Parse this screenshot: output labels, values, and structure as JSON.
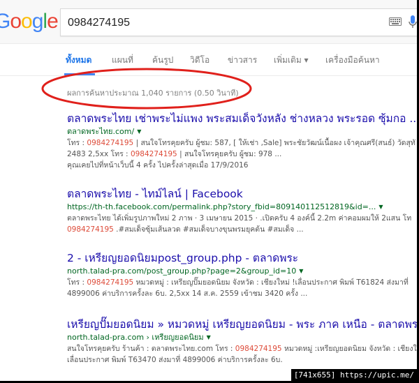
{
  "search": {
    "logo_letters": [
      {
        "ch": "G",
        "color": "#4285f4"
      },
      {
        "ch": "o",
        "color": "#ea4335"
      },
      {
        "ch": "o",
        "color": "#fbbc05"
      },
      {
        "ch": "g",
        "color": "#4285f4"
      },
      {
        "ch": "l",
        "color": "#34a853"
      },
      {
        "ch": "e",
        "color": "#ea4335"
      }
    ],
    "query": "0984274195"
  },
  "tabs": [
    "ทั้งหมด",
    "แผนที่",
    "ค้นรูป",
    "วิดีโอ",
    "ข่าวสาร",
    "เพิ่มเติม ▾",
    "เครื่องมือค้นหา"
  ],
  "stats": "ผลการค้นหาประมาณ 1,040 รายการ (0.50 วินาที)",
  "results": [
    {
      "title": "ตลาดพระไทย เช่าพระไม่แพง พระสมเด็จวังหลัง ช่างหลวง พระรอด ซุ้มกอ ...",
      "url": "ตลาดพระไทย.com/",
      "snippet_lines": [
        [
          {
            "t": "โทร : "
          },
          {
            "t": "0984274195",
            "hl": true
          },
          {
            "t": " | สนใจโทรคุยครับ ผู้ชม: 587, [ ให้เช่า ,Sale] พระชัยวัฒน์เนื้อผง เจ้าคุณศรี(สนธ์) วัดสุทั"
          }
        ],
        [
          {
            "t": "2483 2,5xx โทร : "
          },
          {
            "t": "0984274195",
            "hl": true
          },
          {
            "t": " | สนใจโทรคุยครับ ผู้ชม: 978 ..."
          }
        ]
      ],
      "visited": "คุณเคยไปที่หน้าเว็บนี้ 4 ครั้ง ไปครั้งล่าสุดเมื่อ 17/9/2016"
    },
    {
      "title": "ตลาดพระไทย - ไทม์ไลน์ | Facebook",
      "url": "https://th-th.facebook.com/permalink.php?story_fbid=809140112512819&id=...",
      "snippet_lines": [
        [
          {
            "t": "ตลาดพระไทย ได้เพิ่มรูปภาพใหม่ 2 ภาพ · 3 เมษายน 2015 · .เปิดครับ 4 องค์นี้ 2.2m ค่าคอมผมให้ 2แสน โท"
          }
        ],
        [
          {
            "t": "0984274195",
            "hl": true
          },
          {
            "t": " .#สมเด็จซุ้มเส้นลวด #สมเด็จบางขุนพรมยุคต้น #สมเด็จ ..."
          }
        ]
      ],
      "visited": ""
    },
    {
      "title": "2 - เหรียญยอดนิยมpost_group.php - ตลาดพระ",
      "url": "north.talad-pra.com/post_group.php?page=2&group_id=10",
      "snippet_lines": [
        [
          {
            "t": "โทร : "
          },
          {
            "t": "0984274195",
            "hl": true
          },
          {
            "t": " หมวดหมู่ : เหรียญปั๊มยอดนิยม จังหวัด : เชียงใหม่ !เลื่อนประกาศ พิมพ์ T61824 ส่งมาที่"
          }
        ],
        [
          {
            "t": "4899006 ค่าบริการครั้งละ 6บ. 2,5xx 14 ส.ค. 2559 เข้าชม 3420 ครั้ง ..."
          }
        ]
      ],
      "visited": ""
    },
    {
      "title": "เหรียญปั๊มยอดนิยม » หมวดหมู่ เหรียญยอดนิยม - พระ ภาค เหนือ - ตลาดพระ",
      "url": "north.talad-pra.com › เหรียญยอดนิยม",
      "snippet_lines": [
        [
          {
            "t": "สนใจโทรคุยครับ ร้านค้า : ตลาดพระไทย.com โทร : "
          },
          {
            "t": "0984274195",
            "hl": true
          },
          {
            "t": " หมวดหมู่ :เหรียญยอดนิยม จังหวัด : เชียงใหม่ !"
          }
        ],
        [
          {
            "t": "เลื่อนประกาศ พิมพ์ T63470 ส่งมาที่ 4899006 ค่าบริการครั้งละ 6บ."
          }
        ]
      ],
      "visited": ""
    }
  ],
  "watermark": "[741x655] https://upic.me/",
  "colors": {
    "title_link": "#1a0dab",
    "url_green": "#006621",
    "highlight_red": "#dd4b39",
    "active_tab": "#1a73e8",
    "annotation_ellipse": "#e0201b"
  },
  "icons": [
    "keyboard-icon",
    "microphone-icon",
    "dropdown-caret-icon"
  ]
}
